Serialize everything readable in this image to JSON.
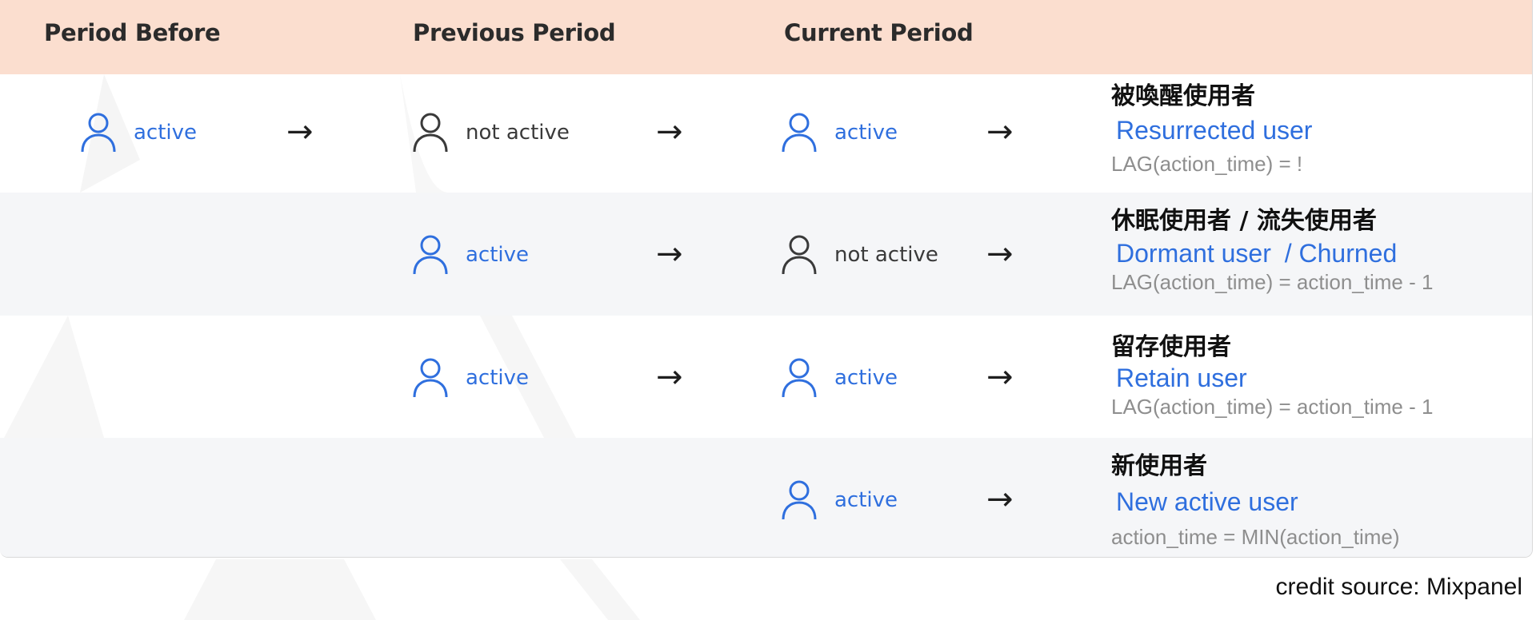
{
  "header": {
    "col1": "Period Before",
    "col2": "Previous Period",
    "col3": "Current Period"
  },
  "states": {
    "active": "active",
    "not_active": "not active"
  },
  "arrow": "→",
  "rows": [
    {
      "zh": "被喚醒使用者",
      "en": "Resurrected user",
      "formula": "LAG(action_time) = !"
    },
    {
      "zh": "休眠使用者 / 流失使用者",
      "en": "Dormant user",
      "en2": "/ Churned",
      "formula": "LAG(action_time) = action_time - 1"
    },
    {
      "zh": "留存使用者",
      "en": "Retain user",
      "formula": "LAG(action_time) = action_time - 1"
    },
    {
      "zh": "新使用者",
      "en": "New active user",
      "formula": "action_time = MIN(action_time)"
    }
  ],
  "credit": "credit source: Mixpanel",
  "colors": {
    "header_bg": "#fbdecf",
    "active": "#2f6fde",
    "inactive": "#3a3a3a",
    "formula": "#8e8e8e",
    "row_alt": "#f4f5f7"
  },
  "icons": [
    "user-icon",
    "arrow-right-icon"
  ]
}
